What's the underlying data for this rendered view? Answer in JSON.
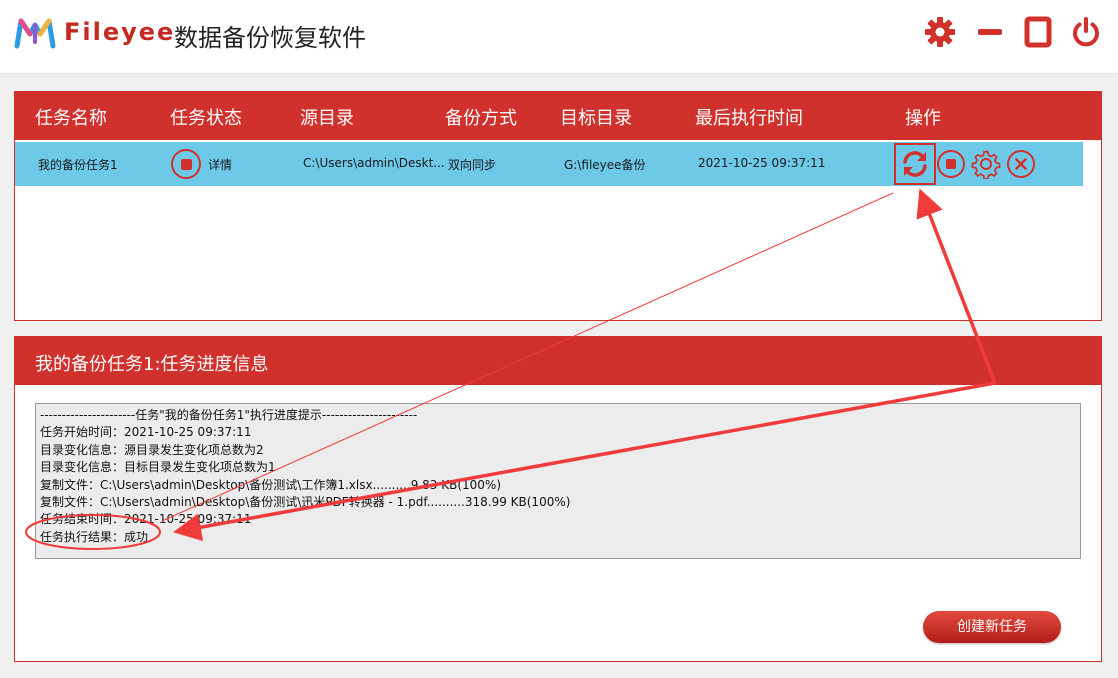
{
  "app": {
    "brand": "Fileyee",
    "title": "数据备份恢复软件"
  },
  "window_controls": [
    {
      "icon": "gear-icon",
      "action": "settings"
    },
    {
      "icon": "minimize-icon",
      "action": "minimize"
    },
    {
      "icon": "maximize-icon",
      "action": "maximize"
    },
    {
      "icon": "power-icon",
      "action": "close"
    }
  ],
  "task_table": {
    "columns": [
      "任务名称",
      "任务状态",
      "源目录",
      "备份方式",
      "目标目录",
      "最后执行时间",
      "操作"
    ],
    "rows": [
      {
        "name": "我的备份任务1",
        "status_detail": "详情",
        "source": "C:\\Users\\admin\\Deskt...",
        "mode": "双向同步",
        "target": "G:\\fileyee备份",
        "last_run": "2021-10-25 09:37:11",
        "operations": [
          "sync-icon",
          "stop-icon",
          "settings-icon",
          "delete-icon"
        ]
      }
    ]
  },
  "progress": {
    "title": "我的备份任务1:任务进度信息",
    "log": [
      "----------------------任务\"我的备份任务1\"执行进度提示----------------------",
      "任务开始时间：2021-10-25 09:37:11",
      "目录变化信息：源目录发生变化项总数为2",
      "目录变化信息：目标目录发生变化项总数为1",
      "复制文件：C:\\Users\\admin\\Desktop\\备份测试\\工作簿1.xlsx..........9.83 KB(100%)",
      "复制文件：C:\\Users\\admin\\Desktop\\备份测试\\迅米PDF转换器 - 1.pdf..........318.99 KB(100%)",
      "任务结束时间：2021-10-25 09:37:11",
      "任务执行结果：成功"
    ]
  },
  "actions": {
    "create_task_label": "创建新任务"
  },
  "colors": {
    "accent": "#d0312d",
    "row_selected": "#6ec8e8"
  }
}
